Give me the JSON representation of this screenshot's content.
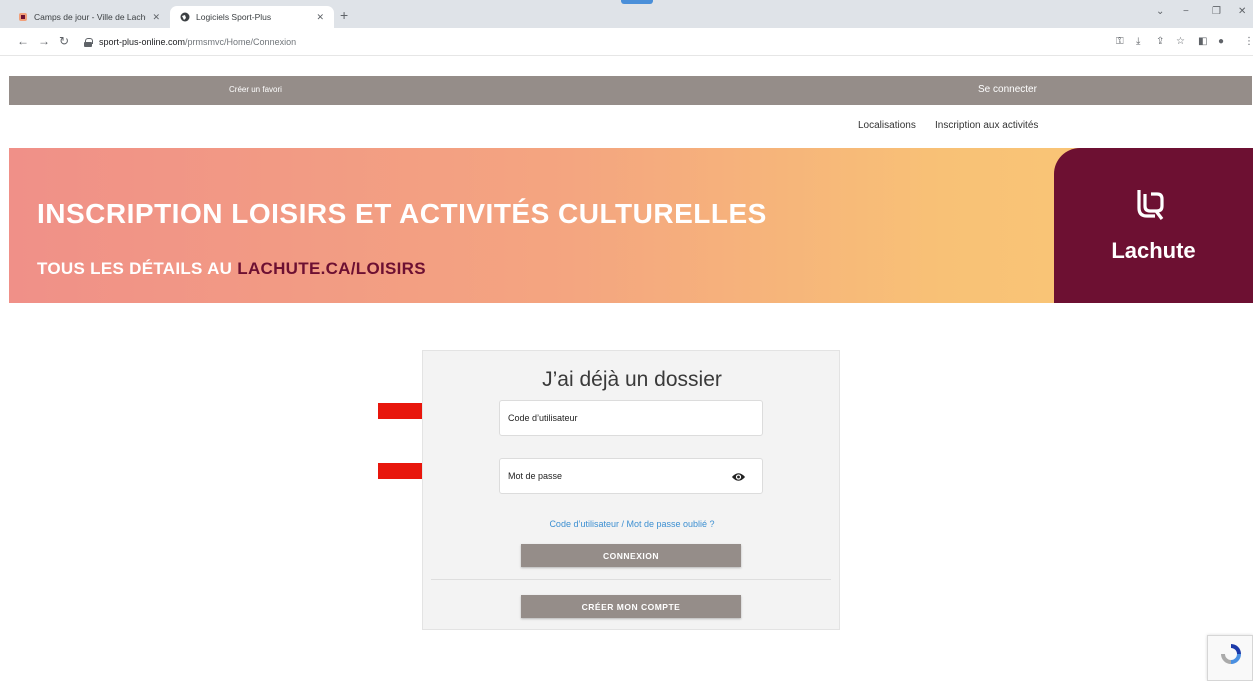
{
  "browser": {
    "tabs": [
      {
        "title": "Camps de jour - Ville de Lachute",
        "active": false
      },
      {
        "title": "Logiciels Sport-Plus",
        "active": true
      }
    ],
    "url_host": "sport-plus-online.com",
    "url_path": "/prmsmvc/Home/Connexion"
  },
  "topbar": {
    "favorite_link": "Créer un favori",
    "login_link": "Se connecter"
  },
  "subnav": {
    "items": [
      "Localisations",
      "Inscription aux activités"
    ]
  },
  "banner": {
    "title": "INSCRIPTION LOISIRS ET ACTIVITÉS CULTURELLES",
    "subtitle_prefix": "TOUS LES DÉTAILS AU ",
    "subtitle_highlight": "LACHUTE.CA/LOISIRS",
    "logo_text": "Lachute",
    "colors": {
      "gradient_start": "#f09088",
      "gradient_end": "#fbc977",
      "brand": "#6d1032"
    }
  },
  "login": {
    "title": "J’ai déjà un dossier",
    "username_placeholder": "Code d’utilisateur",
    "password_placeholder": "Mot de passe",
    "forgot_link": "Code d’utilisateur / Mot de passe oublié ?",
    "connect_button": "CONNEXION",
    "create_button": "CRÉER MON COMPTE"
  },
  "annotations": {
    "arrow_color": "#e8160c"
  },
  "icons": [
    "lock-icon",
    "eye-icon",
    "recaptcha-icon",
    "lachute-logo-icon"
  ]
}
